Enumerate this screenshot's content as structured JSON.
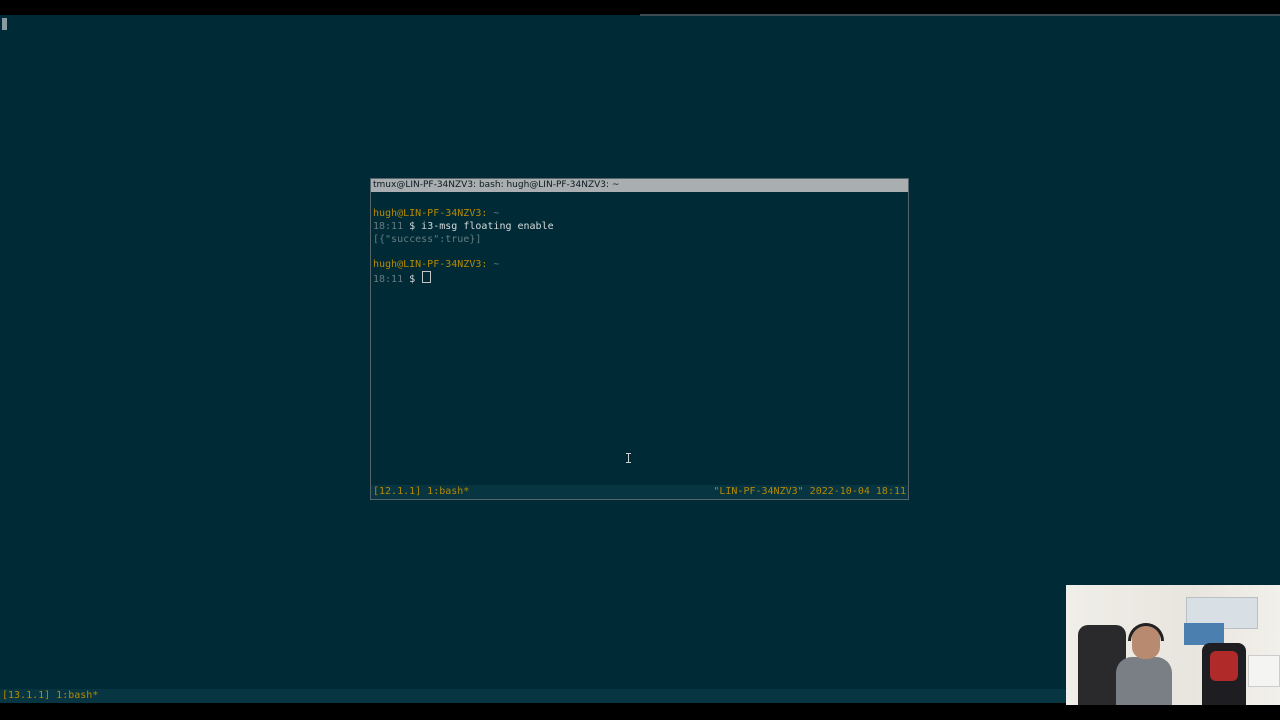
{
  "window": {
    "title": "tmux@LIN-PF-34NZV3: bash: hugh@LIN-PF-34NZV3: ~"
  },
  "terminal": {
    "lines": [
      {
        "user_host": "hugh@LIN-PF-34NZV3:",
        "path": " ~"
      },
      {
        "time": "18:11",
        "prompt": " $ ",
        "command": "i3-msg floating enable"
      },
      {
        "output": "[{\"success\":true}]"
      },
      {
        "user_host": "hugh@LIN-PF-34NZV3:",
        "path": " ~"
      },
      {
        "time": "18:11",
        "prompt": " $ ",
        "command": ""
      }
    ]
  },
  "tmux_status": {
    "left": "[12.1.1] 1:bash*",
    "right": "\"LIN-PF-34NZV3\" 2022-10-04 18:11"
  },
  "bottom_status": {
    "left": "[13.1.1] 1:bash*"
  },
  "colors": {
    "background": "#002b36",
    "status_bar": "#073642",
    "accent_yellow": "#b58900",
    "titlebar": "#a9aeb0"
  },
  "icons": {
    "mouse_cursor": "ibeam-cursor-icon",
    "terminal_cursor": "block-cursor-icon"
  },
  "webcam": {
    "type": "webcam-overlay"
  }
}
